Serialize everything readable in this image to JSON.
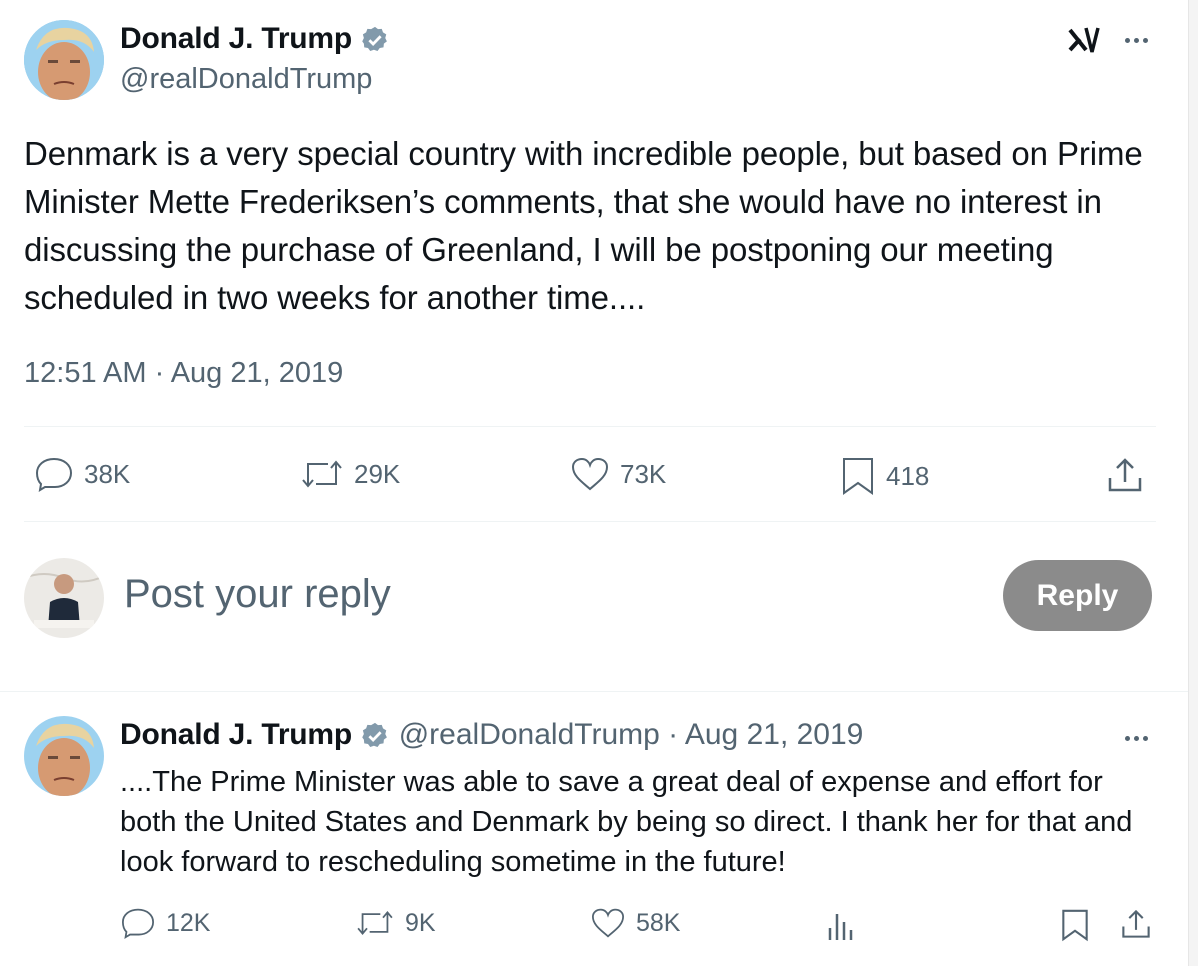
{
  "main_tweet": {
    "author_name": "Donald J. Trump",
    "author_handle": "@realDonaldTrump",
    "text": "Denmark is a very special country with incredible people, but based on Prime Minister Mette Frederiksen’s comments, that she would have no interest in discussing the purchase of Greenland, I will be postponing our meeting scheduled in two weeks for another time....",
    "timestamp": "12:51 AM · Aug 21, 2019",
    "stats": {
      "replies": "38K",
      "reposts": "29K",
      "likes": "73K",
      "bookmarks": "418"
    }
  },
  "composer": {
    "placeholder": "Post your reply",
    "button_label": "Reply"
  },
  "reply_tweet": {
    "author_name": "Donald J. Trump",
    "author_handle": "@realDonaldTrump",
    "separator": "·",
    "date": "Aug 21, 2019",
    "text": "....The Prime Minister was able to save a great deal of expense and effort for both the United States and Denmark by being so direct. I thank her for that and look forward to rescheduling sometime in the future!",
    "stats": {
      "replies": "12K",
      "reposts": "9K",
      "likes": "58K"
    }
  },
  "colors": {
    "verified": "#829aab",
    "muted": "#536471",
    "reply_button": "#8b8b8b"
  },
  "icons": [
    "grok-icon",
    "more-icon",
    "reply-icon",
    "repost-icon",
    "like-icon",
    "bookmark-icon",
    "share-icon",
    "views-icon"
  ]
}
